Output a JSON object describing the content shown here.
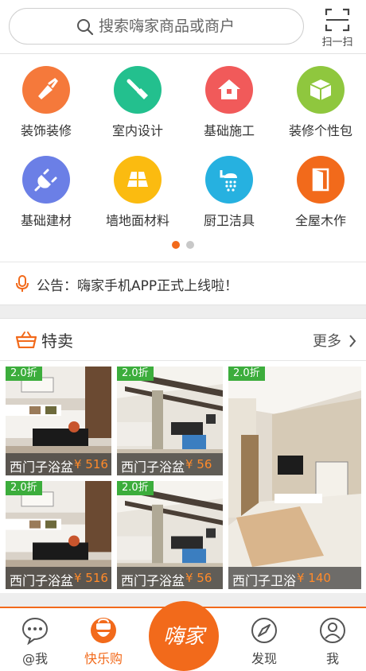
{
  "search": {
    "placeholder": "搜索嗨家商品或商户"
  },
  "scan": {
    "label": "扫一扫"
  },
  "categories": [
    {
      "label": "装饰装修",
      "icon": "trowel-icon",
      "color": "#f5793b"
    },
    {
      "label": "室内设计",
      "icon": "brush-icon",
      "color": "#23c08e"
    },
    {
      "label": "基础施工",
      "icon": "house-icon",
      "color": "#f15a5a"
    },
    {
      "label": "装修个性包",
      "icon": "box-icon",
      "color": "#8fc73e"
    },
    {
      "label": "基础建材",
      "icon": "plug-icon",
      "color": "#6b7fe6"
    },
    {
      "label": "墙地面材料",
      "icon": "tiles-icon",
      "color": "#fbbb10"
    },
    {
      "label": "厨卫洁具",
      "icon": "shower-icon",
      "color": "#26b1e0"
    },
    {
      "label": "全屋木作",
      "icon": "door-icon",
      "color": "#f26a1b"
    }
  ],
  "pager": {
    "active_color": "#f26a1b",
    "inactive_color": "#c8c8c8",
    "pages": 2,
    "active": 1
  },
  "notice": {
    "text": "公告：嗨家手机APP正式上线啦！"
  },
  "sale": {
    "title": "特卖",
    "more": "更多"
  },
  "products": [
    {
      "badge": "2.0折",
      "name": "西门子浴盆",
      "price": "¥ 516",
      "image": "living-room"
    },
    {
      "badge": "2.0折",
      "name": "西门子浴盆",
      "price": "¥ 56",
      "image": "kitchen"
    },
    {
      "badge": "2.0折",
      "name": "西门子卫浴",
      "price": "¥ 140",
      "image": "tv-room"
    },
    {
      "badge": "2.0折",
      "name": "西门子浴盆",
      "price": "¥ 516",
      "image": "living-room"
    },
    {
      "badge": "2.0折",
      "name": "西门子浴盆",
      "price": "¥ 56",
      "image": "kitchen"
    }
  ],
  "tabs": [
    {
      "label": "@我",
      "icon": "chat-bubble-icon",
      "active": false
    },
    {
      "label": "快乐购",
      "icon": "smile-bag-icon",
      "active": true
    },
    {
      "label": "嗨家",
      "icon": "logo",
      "active": false
    },
    {
      "label": "发现",
      "icon": "compass-icon",
      "active": false
    },
    {
      "label": "我",
      "icon": "user-icon",
      "active": false
    }
  ],
  "colors": {
    "accent": "#f26a1b",
    "badge": "#3cad3c",
    "price": "#ff8a2a"
  }
}
